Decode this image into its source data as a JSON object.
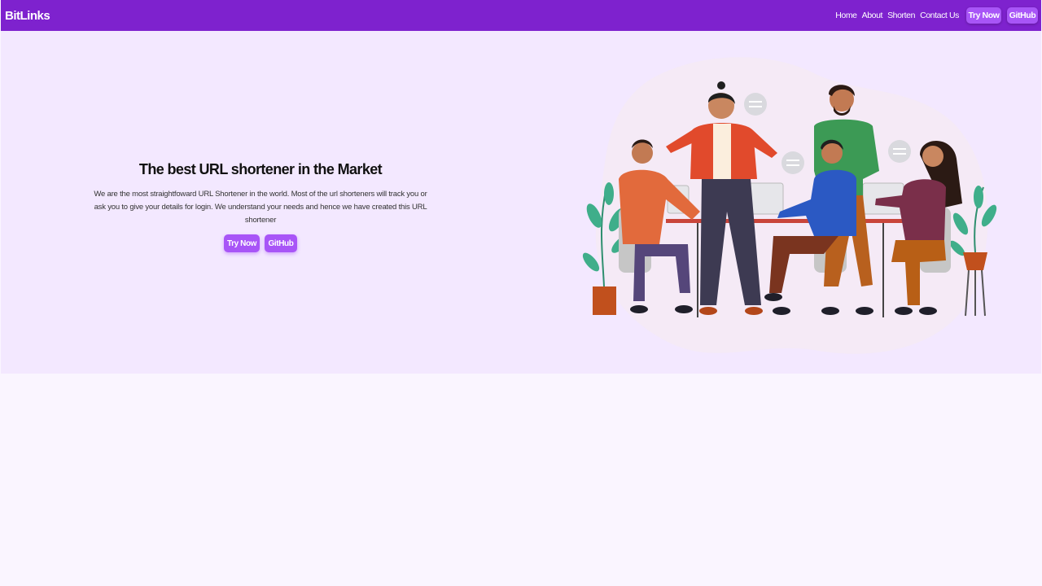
{
  "brand": {
    "name": "BitLinks",
    "primary_color": "#7e22ce",
    "button_color": "#a855f7",
    "hero_background": "#f3e8ff",
    "page_background": "#faf5ff"
  },
  "nav": {
    "links": [
      "Home",
      "About",
      "Shorten",
      "Contact Us"
    ],
    "try_now_label": "Try Now",
    "github_label": "GitHub"
  },
  "hero": {
    "title": "The best URL shortener in the Market",
    "description": "We are the most straightfoward URL Shortener in the world. Most of the url shorteners will track you or ask you to give your details for login. We understand your needs and hence we have created this URL shortener",
    "try_now_label": "Try Now",
    "github_label": "GitHub",
    "illustration": "team-meeting-illustration"
  }
}
